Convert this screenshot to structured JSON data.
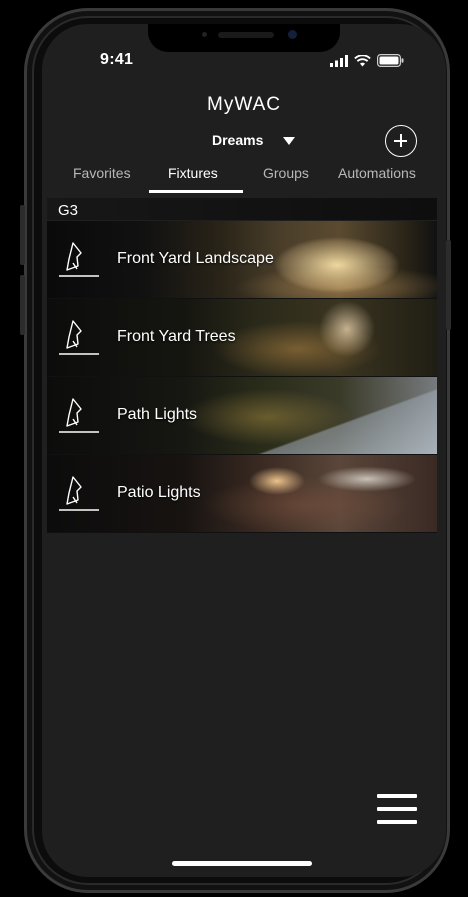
{
  "status_bar": {
    "time": "9:41"
  },
  "app": {
    "title": "MyWAC"
  },
  "location": {
    "name": "Dreams"
  },
  "tabs": [
    {
      "label": "Favorites",
      "active": false
    },
    {
      "label": "Fixtures",
      "active": true
    },
    {
      "label": "Groups",
      "active": false
    },
    {
      "label": "Automations",
      "active": false
    }
  ],
  "group": {
    "label": "G3"
  },
  "fixtures": [
    {
      "label": "Front Yard Landscape",
      "icon": "landscape-fixture-icon"
    },
    {
      "label": "Front Yard Trees",
      "icon": "landscape-fixture-icon"
    },
    {
      "label": "Path Lights",
      "icon": "landscape-fixture-icon"
    },
    {
      "label": "Patio Lights",
      "icon": "landscape-fixture-icon"
    }
  ],
  "colors": {
    "background": "#1f1f1f",
    "text": "#ffffff",
    "inactive_tab": "#b8b8b8"
  }
}
